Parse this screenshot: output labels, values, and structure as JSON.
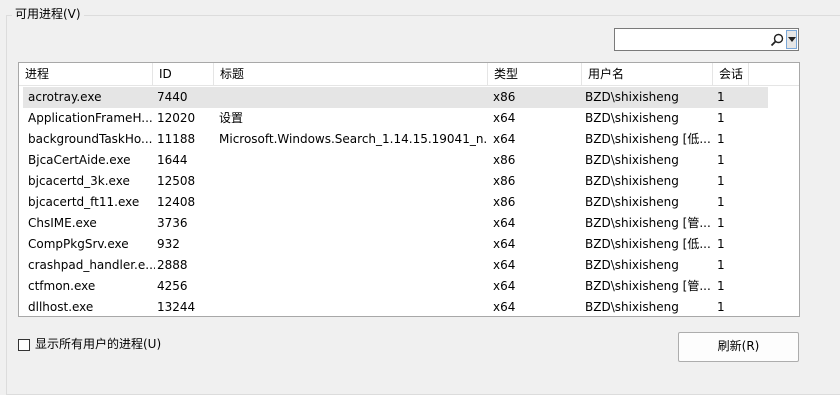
{
  "group": {
    "title": "可用进程(V)"
  },
  "search": {
    "value": "",
    "icon": "search-icon"
  },
  "columns": [
    "进程",
    "ID",
    "标题",
    "类型",
    "用户名",
    "会话"
  ],
  "rows": [
    {
      "process": "acrotray.exe",
      "id": "7440",
      "title": "",
      "type": "x86",
      "user": "BZD\\shixisheng",
      "session": "1",
      "selected": true
    },
    {
      "process": "ApplicationFrameH...",
      "id": "12020",
      "title": "设置",
      "type": "x64",
      "user": "BZD\\shixisheng",
      "session": "1"
    },
    {
      "process": "backgroundTaskHo...",
      "id": "11188",
      "title": "Microsoft.Windows.Search_1.14.15.19041_n...",
      "type": "x64",
      "user": "BZD\\shixisheng [低...",
      "session": "1"
    },
    {
      "process": "BjcaCertAide.exe",
      "id": "1644",
      "title": "",
      "type": "x86",
      "user": "BZD\\shixisheng",
      "session": "1"
    },
    {
      "process": "bjcacertd_3k.exe",
      "id": "12508",
      "title": "",
      "type": "x86",
      "user": "BZD\\shixisheng",
      "session": "1"
    },
    {
      "process": "bjcacertd_ft11.exe",
      "id": "12408",
      "title": "",
      "type": "x86",
      "user": "BZD\\shixisheng",
      "session": "1"
    },
    {
      "process": "ChsIME.exe",
      "id": "3736",
      "title": "",
      "type": "x64",
      "user": "BZD\\shixisheng [管...",
      "session": "1"
    },
    {
      "process": "CompPkgSrv.exe",
      "id": "932",
      "title": "",
      "type": "x64",
      "user": "BZD\\shixisheng [低...",
      "session": "1"
    },
    {
      "process": "crashpad_handler.e...",
      "id": "2888",
      "title": "",
      "type": "x64",
      "user": "BZD\\shixisheng",
      "session": "1"
    },
    {
      "process": "ctfmon.exe",
      "id": "4256",
      "title": "",
      "type": "x64",
      "user": "BZD\\shixisheng [管...",
      "session": "1"
    },
    {
      "process": "dllhost.exe",
      "id": "13244",
      "title": "",
      "type": "x64",
      "user": "BZD\\shixisheng",
      "session": "1"
    }
  ],
  "footer": {
    "show_all_label": "显示所有用户的进程(U)",
    "show_all_checked": false,
    "refresh_label": "刷新(R)"
  }
}
